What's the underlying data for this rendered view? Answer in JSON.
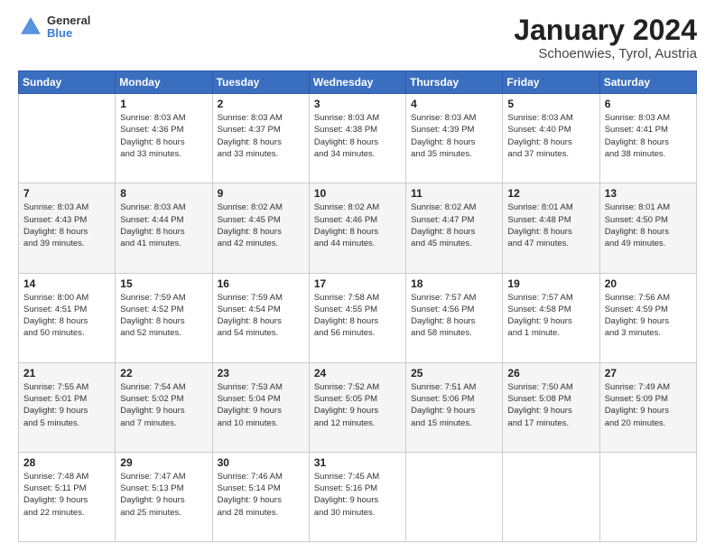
{
  "header": {
    "logo_line1": "General",
    "logo_line2": "Blue",
    "title": "January 2024",
    "subtitle": "Schoenwies, Tyrol, Austria"
  },
  "calendar": {
    "headers": [
      "Sunday",
      "Monday",
      "Tuesday",
      "Wednesday",
      "Thursday",
      "Friday",
      "Saturday"
    ],
    "weeks": [
      [
        {
          "day": "",
          "info": ""
        },
        {
          "day": "1",
          "info": "Sunrise: 8:03 AM\nSunset: 4:36 PM\nDaylight: 8 hours\nand 33 minutes."
        },
        {
          "day": "2",
          "info": "Sunrise: 8:03 AM\nSunset: 4:37 PM\nDaylight: 8 hours\nand 33 minutes."
        },
        {
          "day": "3",
          "info": "Sunrise: 8:03 AM\nSunset: 4:38 PM\nDaylight: 8 hours\nand 34 minutes."
        },
        {
          "day": "4",
          "info": "Sunrise: 8:03 AM\nSunset: 4:39 PM\nDaylight: 8 hours\nand 35 minutes."
        },
        {
          "day": "5",
          "info": "Sunrise: 8:03 AM\nSunset: 4:40 PM\nDaylight: 8 hours\nand 37 minutes."
        },
        {
          "day": "6",
          "info": "Sunrise: 8:03 AM\nSunset: 4:41 PM\nDaylight: 8 hours\nand 38 minutes."
        }
      ],
      [
        {
          "day": "7",
          "info": "Sunrise: 8:03 AM\nSunset: 4:43 PM\nDaylight: 8 hours\nand 39 minutes."
        },
        {
          "day": "8",
          "info": "Sunrise: 8:03 AM\nSunset: 4:44 PM\nDaylight: 8 hours\nand 41 minutes."
        },
        {
          "day": "9",
          "info": "Sunrise: 8:02 AM\nSunset: 4:45 PM\nDaylight: 8 hours\nand 42 minutes."
        },
        {
          "day": "10",
          "info": "Sunrise: 8:02 AM\nSunset: 4:46 PM\nDaylight: 8 hours\nand 44 minutes."
        },
        {
          "day": "11",
          "info": "Sunrise: 8:02 AM\nSunset: 4:47 PM\nDaylight: 8 hours\nand 45 minutes."
        },
        {
          "day": "12",
          "info": "Sunrise: 8:01 AM\nSunset: 4:48 PM\nDaylight: 8 hours\nand 47 minutes."
        },
        {
          "day": "13",
          "info": "Sunrise: 8:01 AM\nSunset: 4:50 PM\nDaylight: 8 hours\nand 49 minutes."
        }
      ],
      [
        {
          "day": "14",
          "info": "Sunrise: 8:00 AM\nSunset: 4:51 PM\nDaylight: 8 hours\nand 50 minutes."
        },
        {
          "day": "15",
          "info": "Sunrise: 7:59 AM\nSunset: 4:52 PM\nDaylight: 8 hours\nand 52 minutes."
        },
        {
          "day": "16",
          "info": "Sunrise: 7:59 AM\nSunset: 4:54 PM\nDaylight: 8 hours\nand 54 minutes."
        },
        {
          "day": "17",
          "info": "Sunrise: 7:58 AM\nSunset: 4:55 PM\nDaylight: 8 hours\nand 56 minutes."
        },
        {
          "day": "18",
          "info": "Sunrise: 7:57 AM\nSunset: 4:56 PM\nDaylight: 8 hours\nand 58 minutes."
        },
        {
          "day": "19",
          "info": "Sunrise: 7:57 AM\nSunset: 4:58 PM\nDaylight: 9 hours\nand 1 minute."
        },
        {
          "day": "20",
          "info": "Sunrise: 7:56 AM\nSunset: 4:59 PM\nDaylight: 9 hours\nand 3 minutes."
        }
      ],
      [
        {
          "day": "21",
          "info": "Sunrise: 7:55 AM\nSunset: 5:01 PM\nDaylight: 9 hours\nand 5 minutes."
        },
        {
          "day": "22",
          "info": "Sunrise: 7:54 AM\nSunset: 5:02 PM\nDaylight: 9 hours\nand 7 minutes."
        },
        {
          "day": "23",
          "info": "Sunrise: 7:53 AM\nSunset: 5:04 PM\nDaylight: 9 hours\nand 10 minutes."
        },
        {
          "day": "24",
          "info": "Sunrise: 7:52 AM\nSunset: 5:05 PM\nDaylight: 9 hours\nand 12 minutes."
        },
        {
          "day": "25",
          "info": "Sunrise: 7:51 AM\nSunset: 5:06 PM\nDaylight: 9 hours\nand 15 minutes."
        },
        {
          "day": "26",
          "info": "Sunrise: 7:50 AM\nSunset: 5:08 PM\nDaylight: 9 hours\nand 17 minutes."
        },
        {
          "day": "27",
          "info": "Sunrise: 7:49 AM\nSunset: 5:09 PM\nDaylight: 9 hours\nand 20 minutes."
        }
      ],
      [
        {
          "day": "28",
          "info": "Sunrise: 7:48 AM\nSunset: 5:11 PM\nDaylight: 9 hours\nand 22 minutes."
        },
        {
          "day": "29",
          "info": "Sunrise: 7:47 AM\nSunset: 5:13 PM\nDaylight: 9 hours\nand 25 minutes."
        },
        {
          "day": "30",
          "info": "Sunrise: 7:46 AM\nSunset: 5:14 PM\nDaylight: 9 hours\nand 28 minutes."
        },
        {
          "day": "31",
          "info": "Sunrise: 7:45 AM\nSunset: 5:16 PM\nDaylight: 9 hours\nand 30 minutes."
        },
        {
          "day": "",
          "info": ""
        },
        {
          "day": "",
          "info": ""
        },
        {
          "day": "",
          "info": ""
        }
      ]
    ]
  }
}
